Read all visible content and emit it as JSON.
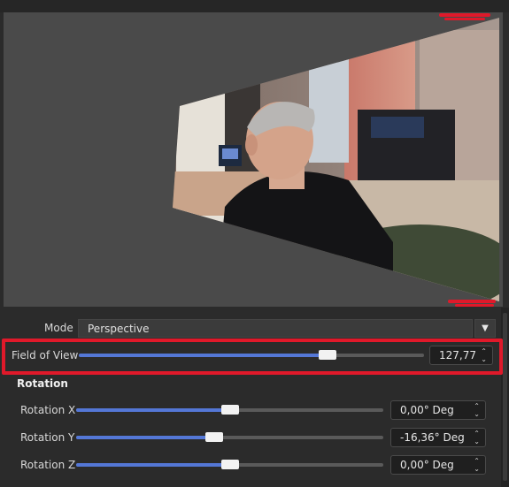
{
  "mode": {
    "label": "Mode",
    "value": "Perspective",
    "arrow_icon": "chevron-down-icon"
  },
  "fov": {
    "label": "Field of View",
    "value": "127,77",
    "level": 0.72
  },
  "rotation": {
    "title": "Rotation",
    "rows": [
      {
        "label": "Rotation X",
        "value": "0,00° Deg",
        "level": 0.5
      },
      {
        "label": "Rotation Y",
        "value": "-16,36° Deg",
        "level": 0.45
      },
      {
        "label": "Rotation Z",
        "value": "0,00° Deg",
        "level": 0.5
      }
    ]
  },
  "colors": {
    "accent": "#5477d6",
    "highlight": "#e0192a"
  }
}
